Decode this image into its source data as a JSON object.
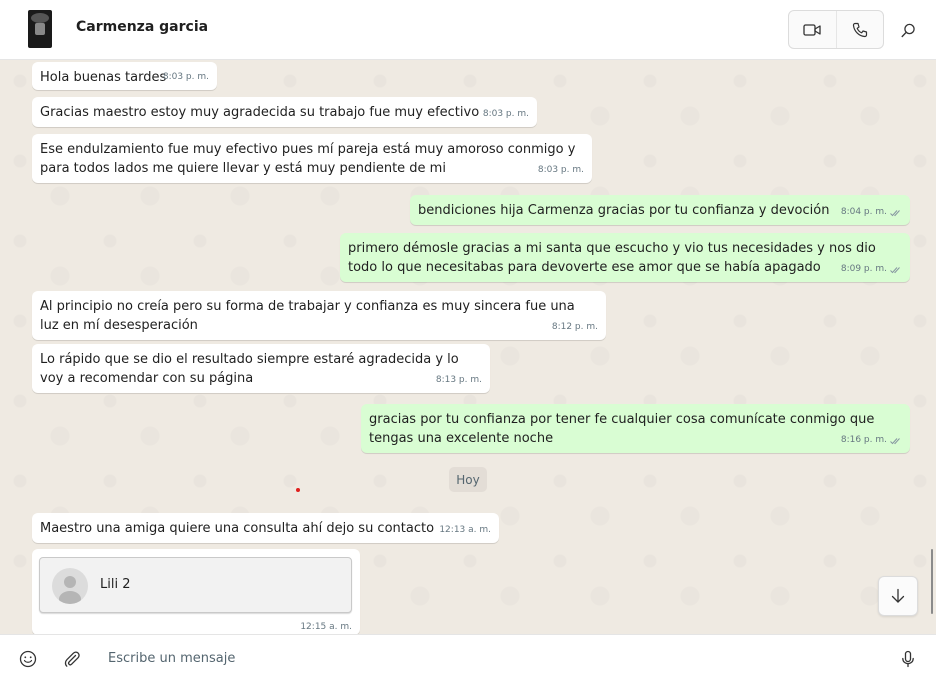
{
  "header": {
    "contact_name": "Carmenza garcia",
    "icons": [
      "video-call-icon",
      "voice-call-icon",
      "search-icon"
    ]
  },
  "messages": [
    {
      "direction": "in",
      "text": "Hola buenas tardes",
      "time": "8:03 p. m."
    },
    {
      "direction": "in",
      "text": "Gracias maestro estoy muy agradecida su trabajo fue muy efectivo",
      "time": "8:03 p. m."
    },
    {
      "direction": "in",
      "text": "Ese endulzamiento fue muy efectivo pues mí pareja está muy amoroso conmigo y para todos lados me quiere llevar y está muy pendiente de mi",
      "time": "8:03 p. m."
    },
    {
      "direction": "out",
      "text": "bendiciones hija Carmenza gracias por tu confianza y devoción",
      "time": "8:04 p. m.",
      "status": "read"
    },
    {
      "direction": "out",
      "text": "primero démosle gracias a mi santa que escucho y vio tus necesidades y nos dio todo lo que necesitabas para devoverte ese amor que se había apagado",
      "time": "8:09 p. m.",
      "status": "read"
    },
    {
      "direction": "in",
      "text": "Al principio no creía pero su forma de trabajar y confianza es  muy sincera fue una luz en mí desesperación",
      "time": "8:12 p. m."
    },
    {
      "direction": "in",
      "text": "Lo rápido que se dio el resultado siempre estaré agradecida y lo voy a recomendar con su página",
      "time": "8:13 p. m."
    },
    {
      "direction": "out",
      "text": "gracias por tu confianza por tener fe cualquier cosa comunícate conmigo que tengas una excelente noche",
      "time": "8:16 p. m.",
      "status": "read"
    },
    {
      "direction": "in",
      "text": "Maestro una amiga quiere una consulta ahí dejo su contacto",
      "time": "12:13 a. m."
    }
  ],
  "day_separator": "Hoy",
  "contact_card": {
    "name": "Lili 2",
    "time": "12:15 a. m."
  },
  "composer": {
    "placeholder": "Escribe un mensaje"
  },
  "colors": {
    "incoming_bubble": "#ffffff",
    "outgoing_bubble": "#d9fdd3",
    "chat_background": "#efeae2",
    "read_ticks": "#8696a0"
  }
}
